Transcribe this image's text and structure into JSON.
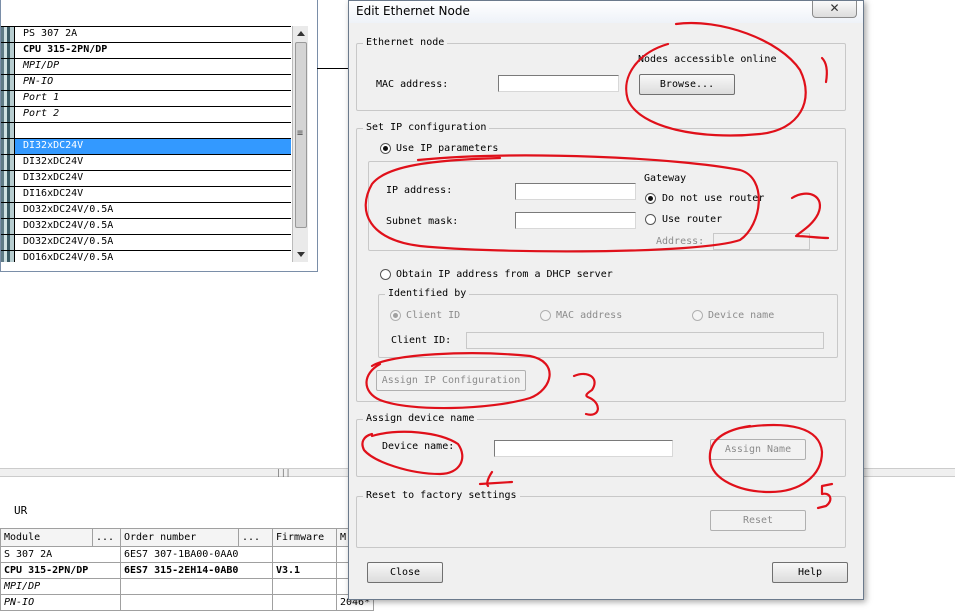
{
  "rack": {
    "rows": [
      {
        "label": "PS 307 2A",
        "style": "normal",
        "selected": false
      },
      {
        "label": "CPU 315-2PN/DP",
        "style": "bold",
        "selected": false
      },
      {
        "label": "MPI/DP",
        "style": "italic",
        "selected": false
      },
      {
        "label": "PN-IO",
        "style": "italic",
        "selected": false
      },
      {
        "label": "Port 1",
        "style": "italic",
        "selected": false
      },
      {
        "label": "Port 2",
        "style": "italic",
        "selected": false
      },
      {
        "label": "",
        "style": "normal",
        "selected": false
      },
      {
        "label": "DI32xDC24V",
        "style": "normal",
        "selected": true
      },
      {
        "label": "DI32xDC24V",
        "style": "normal",
        "selected": false
      },
      {
        "label": "DI32xDC24V",
        "style": "normal",
        "selected": false
      },
      {
        "label": "DI16xDC24V",
        "style": "normal",
        "selected": false
      },
      {
        "label": "DO32xDC24V/0.5A",
        "style": "normal",
        "selected": false
      },
      {
        "label": "DO32xDC24V/0.5A",
        "style": "normal",
        "selected": false
      },
      {
        "label": "DO32xDC24V/0.5A",
        "style": "normal",
        "selected": false
      },
      {
        "label": "DO16xDC24V/0.5A",
        "style": "normal",
        "selected": false
      }
    ],
    "scroll_grip": "≡"
  },
  "splitter_grip": "|||",
  "module_table": {
    "rack_label": "UR",
    "headers": [
      "Module",
      "...",
      "Order number",
      "...",
      "Firmware",
      "M"
    ],
    "rows": [
      [
        "S 307 2A",
        "6ES7 307-1BA00-0AA0",
        "",
        ""
      ],
      [
        "CPU 315-2PN/DP",
        "6ES7 315-2EH14-0AB0",
        "V3.1",
        ""
      ],
      [
        "MPI/DP",
        "",
        "",
        ""
      ],
      [
        "PN-IO",
        "",
        "",
        "2046*"
      ]
    ]
  },
  "dialog": {
    "title": "Edit Ethernet Node",
    "close_glyph": "✕",
    "ethernet_node": {
      "group_title": "Ethernet node",
      "nodes_online_label": "Nodes accessible online",
      "mac_label": "MAC address:",
      "mac_value": "",
      "browse_label": "Browse..."
    },
    "ip_config": {
      "group_title": "Set IP configuration",
      "use_ip_label": "Use IP parameters",
      "ip_label": "IP address:",
      "ip_value": "",
      "subnet_label": "Subnet mask:",
      "subnet_value": "",
      "gateway_label": "Gateway",
      "no_router_label": "Do not use router",
      "use_router_label": "Use router",
      "address_label": "Address:",
      "address_value": "",
      "dhcp_label": "Obtain IP address from a DHCP server",
      "identified_by": {
        "group_title": "Identified by",
        "client_id_label": "Client ID",
        "mac_option_label": "MAC address",
        "device_name_option_label": "Device name",
        "client_id_field_label": "Client ID:",
        "client_id_value": ""
      },
      "assign_ip_label": "Assign IP Configuration"
    },
    "device_name": {
      "group_title": "Assign device name",
      "label": "Device name:",
      "value": "",
      "assign_label": "Assign Name"
    },
    "reset": {
      "group_title": "Reset to factory settings",
      "button_label": "Reset"
    },
    "close_label": "Close",
    "help_label": "Help"
  },
  "annotations": {
    "color": "#e0101a",
    "labels": [
      "1",
      "2",
      "3",
      "4",
      "5"
    ]
  }
}
